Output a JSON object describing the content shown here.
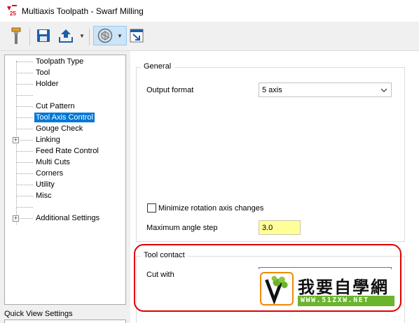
{
  "window": {
    "title": "Multiaxis Toolpath - Swarf Milling"
  },
  "toolbar": {
    "icons": [
      "tool-icon",
      "save-icon",
      "export-icon",
      "tool-axis-icon",
      "apply-icon"
    ]
  },
  "tree": {
    "items": [
      {
        "label": "Toolpath Type"
      },
      {
        "label": "Tool"
      },
      {
        "label": "Holder"
      },
      {
        "label": ""
      },
      {
        "label": "Cut Pattern"
      },
      {
        "label": "Tool Axis Control",
        "selected": true
      },
      {
        "label": "Gouge Check"
      },
      {
        "label": "Linking",
        "expandable": true
      },
      {
        "label": "Feed Rate Control"
      },
      {
        "label": "Multi Cuts"
      },
      {
        "label": "Corners"
      },
      {
        "label": "Utility"
      },
      {
        "label": "Misc"
      },
      {
        "label": ""
      },
      {
        "label": "Additional Settings",
        "expandable": true
      }
    ]
  },
  "quick_view": {
    "label": "Quick View Settings"
  },
  "general": {
    "title": "General",
    "output_format_label": "Output format",
    "output_format_value": "5 axis",
    "minimize_rotation_label": "Minimize rotation axis changes",
    "minimize_rotation_checked": false,
    "max_angle_label": "Maximum angle step",
    "max_angle_value": "3.0"
  },
  "tool_contact": {
    "title": "Tool contact",
    "cut_with_label": "Cut with"
  },
  "watermark": {
    "text": "我要自學網",
    "url": "WWW.51ZXW.NET"
  },
  "colors": {
    "selection": "#0078d7",
    "highlight_ring": "#e00000",
    "input_yellow": "#ffff99",
    "watermark_green": "#6ab42e"
  }
}
